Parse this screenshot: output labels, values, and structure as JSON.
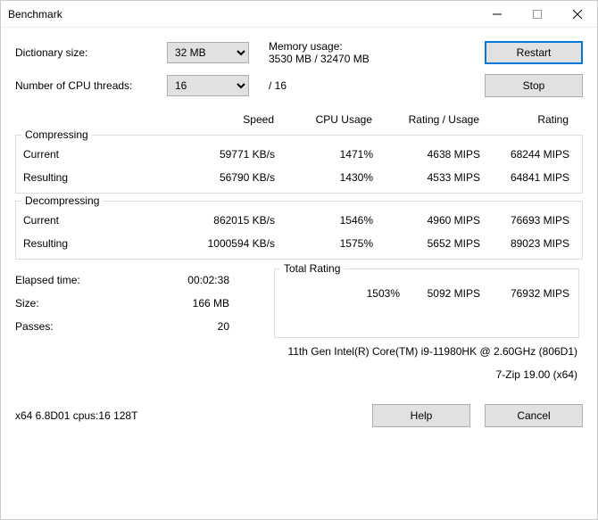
{
  "window": {
    "title": "Benchmark"
  },
  "labels": {
    "dict_size": "Dictionary size:",
    "num_threads": "Number of CPU threads:",
    "memory_usage": "Memory usage:",
    "elapsed": "Elapsed time:",
    "size": "Size:",
    "passes": "Passes:",
    "total_rating": "Total Rating",
    "compressing": "Compressing",
    "decompressing": "Decompressing",
    "current": "Current",
    "resulting": "Resulting"
  },
  "columns": {
    "speed": "Speed",
    "cpu_usage": "CPU Usage",
    "rating_usage": "Rating / Usage",
    "rating": "Rating"
  },
  "buttons": {
    "restart": "Restart",
    "stop": "Stop",
    "help": "Help",
    "cancel": "Cancel"
  },
  "dict_size_value": "32 MB",
  "threads_value": "16",
  "threads_max_suffix": "/ 16",
  "memory_line": "3530 MB / 32470 MB",
  "compressing": {
    "current": {
      "speed": "59771 KB/s",
      "cpu": "1471%",
      "rating_usage": "4638 MIPS",
      "rating": "68244 MIPS"
    },
    "resulting": {
      "speed": "56790 KB/s",
      "cpu": "1430%",
      "rating_usage": "4533 MIPS",
      "rating": "64841 MIPS"
    }
  },
  "decompressing": {
    "current": {
      "speed": "862015 KB/s",
      "cpu": "1546%",
      "rating_usage": "4960 MIPS",
      "rating": "76693 MIPS"
    },
    "resulting": {
      "speed": "1000594 KB/s",
      "cpu": "1575%",
      "rating_usage": "5652 MIPS",
      "rating": "89023 MIPS"
    }
  },
  "elapsed_time": "00:02:38",
  "size_value": "166 MB",
  "passes_value": "20",
  "total": {
    "cpu": "1503%",
    "rating_usage": "5092 MIPS",
    "rating": "76932 MIPS"
  },
  "cpu_info": "11th Gen Intel(R) Core(TM) i9-11980HK @ 2.60GHz (806D1)",
  "app_info": "7-Zip 19.00 (x64)",
  "build_info": "x64 6.8D01 cpus:16 128T"
}
